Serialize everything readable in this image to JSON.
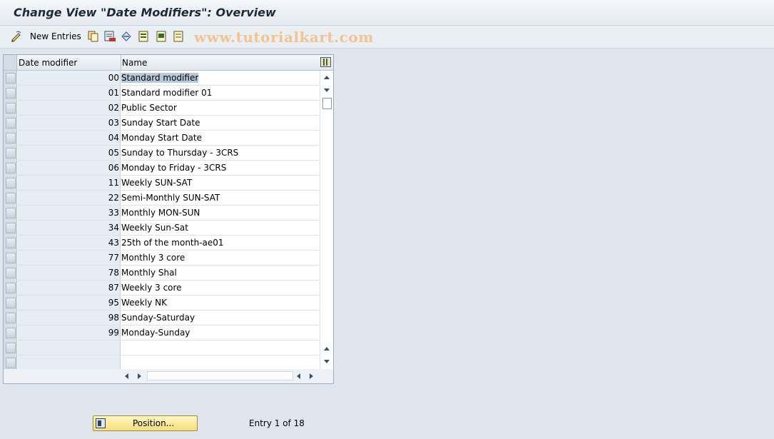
{
  "window": {
    "title": "Change View \"Date Modifiers\": Overview"
  },
  "toolbar": {
    "new_entries_label": "New Entries",
    "icons": [
      "edit-pencil-icon",
      "copy-icon",
      "delete-icon",
      "undo-icon",
      "select-all-icon",
      "select-block-icon",
      "deselect-all-icon"
    ]
  },
  "watermark": "www.tutorialkart.com",
  "table": {
    "columns": [
      "Date modifier",
      "Name"
    ],
    "rows": [
      {
        "code": "00",
        "name": "Standard modifier"
      },
      {
        "code": "01",
        "name": "Standard modifier 01"
      },
      {
        "code": "02",
        "name": "Public Sector"
      },
      {
        "code": "03",
        "name": "Sunday Start Date"
      },
      {
        "code": "04",
        "name": "Monday Start Date"
      },
      {
        "code": "05",
        "name": "Sunday to Thursday - 3CRS"
      },
      {
        "code": "06",
        "name": "Monday to Friday - 3CRS"
      },
      {
        "code": "11",
        "name": "Weekly SUN-SAT"
      },
      {
        "code": "22",
        "name": "Semi-Monthly SUN-SAT"
      },
      {
        "code": "33",
        "name": "Monthly MON-SUN"
      },
      {
        "code": "34",
        "name": "Weekly Sun-Sat"
      },
      {
        "code": "43",
        "name": "25th of the month-ae01"
      },
      {
        "code": "77",
        "name": "Monthly 3 core"
      },
      {
        "code": "78",
        "name": "Monthly Shal"
      },
      {
        "code": "87",
        "name": "Weekly 3 core"
      },
      {
        "code": "95",
        "name": "Weekly NK"
      },
      {
        "code": "98",
        "name": "Sunday-Saturday"
      },
      {
        "code": "99",
        "name": "Monday-Sunday"
      }
    ]
  },
  "footer": {
    "position_button": "Position...",
    "entry_info": "Entry 1 of 18"
  }
}
